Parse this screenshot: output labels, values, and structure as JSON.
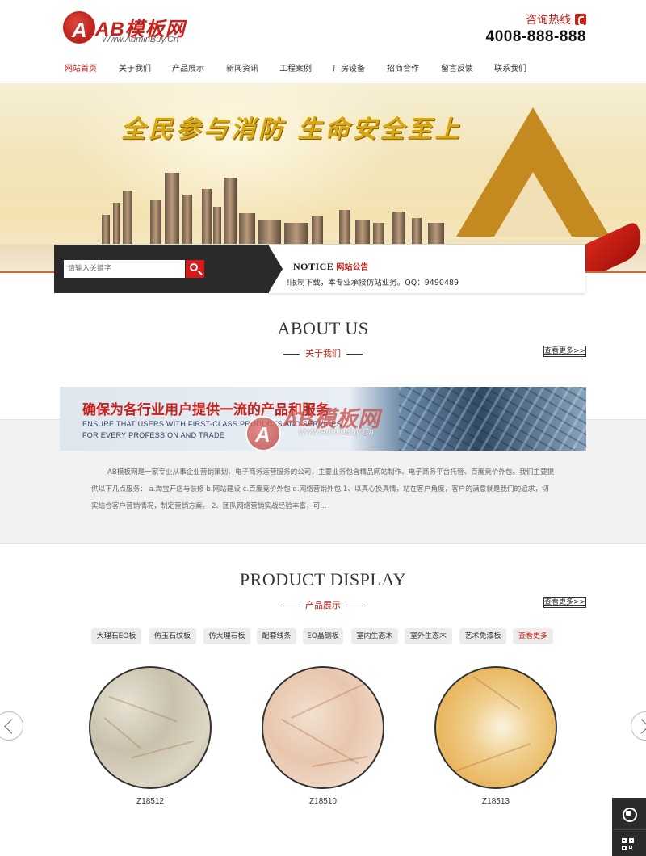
{
  "header": {
    "logo_name": "AB模板网",
    "logo_letter": "A",
    "logo_url": "Www.AdminBuy.Cn",
    "hotline_label": "咨询热线",
    "hotline_number": "4008-888-888"
  },
  "nav": {
    "items": [
      {
        "label": "网站首页",
        "active": true
      },
      {
        "label": "关于我们"
      },
      {
        "label": "产品展示"
      },
      {
        "label": "新闻资讯"
      },
      {
        "label": "工程案例"
      },
      {
        "label": "厂房设备"
      },
      {
        "label": "招商合作"
      },
      {
        "label": "留言反馈"
      },
      {
        "label": "联系我们"
      }
    ]
  },
  "banner": {
    "slogan": "全民参与消防  生命安全至上"
  },
  "search": {
    "placeholder": "请输入关键字"
  },
  "notice": {
    "title_en": "NOTICE",
    "title_cn": "网站公告",
    "text": "!限制下载，本专业承接仿站业务。QQ：9490489"
  },
  "about": {
    "title": "ABOUT US",
    "subtitle": "关于我们",
    "more": "查看更多>>",
    "banner_headline": "确保为各行业用户提供一流的产品和服务",
    "banner_en_line1": "ENSURE THAT USERS WITH FIRST-CLASS PRODUCTS AND SERVICES",
    "banner_en_line2": "FOR EVERY PROFESSION AND TRADE",
    "watermark_name": "AB模板网",
    "watermark_url": "www.AdminBuy.Cn",
    "text": "AB模板网是一家专业从事企业营销策划、电子商务运营服务的公司，主要业务包含精品网站制作、电子商务平台托管、百度竞价外包。我们主要提供以下几点服务： a.淘宝开店与装修 b.网站建设 c.百度竞价外包 d.网络营销外包 1、以真心换真情，站在客户角度，客户的满意就是我们的追求，切实结合客户营销情况，制定营销方案。 2、团队网络营销实战经验丰富，可..."
  },
  "products": {
    "title": "PRODUCT DISPLAY",
    "subtitle": "产品展示",
    "more": "查看更多>>",
    "tags": [
      "大理石EO板",
      "仿玉石纹板",
      "仿大理石板",
      "配套线条",
      "EO晶钢板",
      "室内生态木",
      "室外生态木",
      "艺术免漆板",
      "查看更多"
    ],
    "items": [
      {
        "name": "Z18512"
      },
      {
        "name": "Z18510"
      },
      {
        "name": "Z18513"
      }
    ]
  },
  "colors": {
    "accent": "#c8201a",
    "dark": "#2a2a2a"
  }
}
